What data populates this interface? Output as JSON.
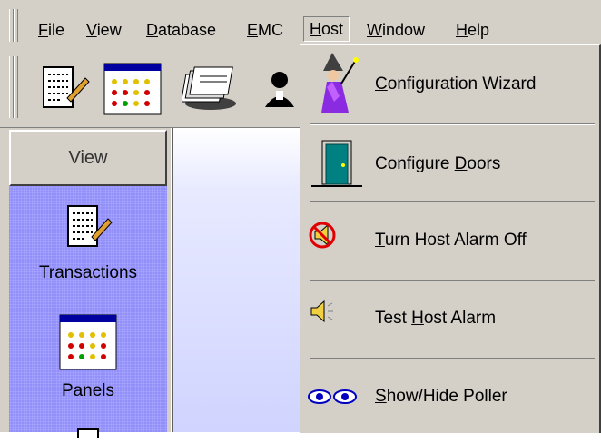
{
  "menubar": {
    "items": [
      {
        "pre": "",
        "acc": "F",
        "post": "ile"
      },
      {
        "pre": "",
        "acc": "V",
        "post": "iew"
      },
      {
        "pre": "",
        "acc": "D",
        "post": "atabase"
      },
      {
        "pre": "",
        "acc": "E",
        "post": "MC"
      },
      {
        "pre": "",
        "acc": "H",
        "post": "ost"
      },
      {
        "pre": "",
        "acc": "W",
        "post": "indow"
      },
      {
        "pre": "",
        "acc": "H",
        "post": "elp"
      }
    ]
  },
  "toolbar": {
    "buttons": [
      "transactions-icon",
      "panels-icon",
      "cardholders-icon",
      "person-icon"
    ]
  },
  "sidebar": {
    "view_label": "View",
    "items": [
      {
        "label": "Transactions",
        "icon": "transactions-icon"
      },
      {
        "label": "Panels",
        "icon": "panels-icon"
      }
    ]
  },
  "host_menu": {
    "items": [
      {
        "pre": "",
        "acc": "C",
        "post": "onfiguration Wizard",
        "icon": "wizard-icon"
      },
      {
        "pre": "Configure ",
        "acc": "D",
        "post": "oors",
        "icon": "door-icon"
      },
      {
        "pre": "",
        "acc": "T",
        "post": "urn Host Alarm Off",
        "icon": "alarm-off-icon"
      },
      {
        "pre": "Test ",
        "acc": "H",
        "post": "ost Alarm",
        "icon": "speaker-icon"
      },
      {
        "pre": "",
        "acc": "S",
        "post": "how/Hide Poller",
        "icon": "eyes-icon"
      }
    ]
  },
  "colors": {
    "chrome": "#d4d0c8",
    "bar_panel": "#9290f8",
    "wizard_robe": "#8a2be2",
    "door": "#008080"
  }
}
